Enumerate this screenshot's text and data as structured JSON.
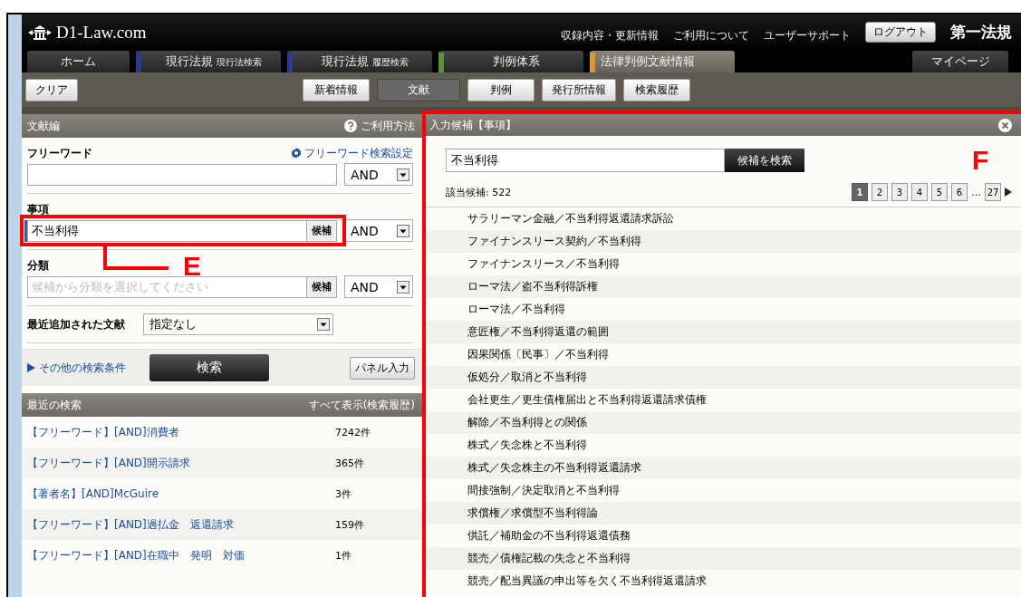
{
  "header": {
    "logo": "D1-Law.com",
    "links": [
      "収録内容・更新情報",
      "ご利用について",
      "ユーザーサポート"
    ],
    "logout_button": "ログアウト",
    "publisher": "第一法規"
  },
  "nav_tabs": [
    {
      "label": "ホーム",
      "selected": false
    },
    {
      "label": "現行法規",
      "sublabel": "現行法検索",
      "color": "#2e3a8c",
      "selected": false
    },
    {
      "label": "現行法規",
      "sublabel": "履歴検索",
      "color": "#2e3a8c",
      "selected": false
    },
    {
      "label": "判例体系",
      "color": "#5f8f45",
      "selected": false
    },
    {
      "label": "法律判例文献情報",
      "color": "#e0952a",
      "selected": true
    }
  ],
  "mypage_tab": "マイページ",
  "toolbar": {
    "clear_button": "クリア",
    "buttons": [
      {
        "label": "新着情報",
        "selected": false
      },
      {
        "label": "文献",
        "selected": true
      },
      {
        "label": "判例",
        "selected": false
      },
      {
        "label": "発行所情報",
        "selected": false
      },
      {
        "label": "検索履歴",
        "selected": false
      }
    ]
  },
  "search_panel": {
    "title": "文献編",
    "help_link": "ご利用方法",
    "fields": [
      {
        "kind": "text",
        "label": "フリーワード",
        "settings_link": "フリーワード検索設定",
        "operator": "AND"
      },
      {
        "kind": "candidate",
        "label": "事項",
        "value": "不当利得",
        "candidate_button": "候補",
        "operator": "AND",
        "focused": true
      },
      {
        "kind": "candidate",
        "label": "分類",
        "placeholder": "候補から分類を選択してください",
        "candidate_button": "候補",
        "operator": "AND"
      },
      {
        "kind": "select",
        "label": "最近追加された文献",
        "value": "指定なし"
      }
    ],
    "more_conditions_link": "その他の検索条件",
    "search_button": "検索",
    "panel_button": "パネル入力"
  },
  "recent_searches": {
    "title": "最近の検索",
    "history_link": "すべて表示(検索履歴)",
    "items": [
      {
        "query": "【フリーワード】[AND]消費者",
        "count": "7242件"
      },
      {
        "query": "【フリーワード】[AND]開示請求",
        "count": "365件"
      },
      {
        "query": "【著者名】[AND]McGuire",
        "count": "3件"
      },
      {
        "query": "【フリーワード】[AND]過払金　返還請求",
        "count": "159件"
      },
      {
        "query": "【フリーワード】[AND]在職中　発明　対価",
        "count": "1件"
      }
    ]
  },
  "candidates_panel": {
    "title": "入力候補【事項】",
    "search_value": "不当利得",
    "search_button": "候補を検索",
    "result_count": "該当候補: 522",
    "pages": [
      {
        "label": "1",
        "selected": true
      },
      {
        "label": "2",
        "selected": false
      },
      {
        "label": "3",
        "selected": false
      },
      {
        "label": "4",
        "selected": false
      },
      {
        "label": "5",
        "selected": false
      },
      {
        "label": "6",
        "selected": false
      }
    ],
    "page_ellipsis": "…",
    "last_page": "27",
    "items": [
      "サラリーマン金融／不当利得返還請求訴訟",
      "ファイナンスリース契約／不当利得",
      "ファイナンスリース／不当利得",
      "ローマ法／盗不当利得訴権",
      "ローマ法／不当利得",
      "意匠権／不当利得返還の範囲",
      "因果関係〔民事〕／不当利得",
      "仮処分／取消と不当利得",
      "会社更生／更生債権届出と不当利得返還請求債権",
      "解除／不当利得との関係",
      "株式／失念株と不当利得",
      "株式／失念株主の不当利得返還請求",
      "間接強制／決定取消と不当利得",
      "求償権／求償型不当利得論",
      "供託／補助金の不当利得返還債務",
      "競売／債権記載の失念と不当利得",
      "競売／配当異議の申出等を欠く不当利得返還請求"
    ]
  },
  "annotations": [
    {
      "kind": "field",
      "label": "E"
    },
    {
      "kind": "panel",
      "label": "F"
    }
  ]
}
